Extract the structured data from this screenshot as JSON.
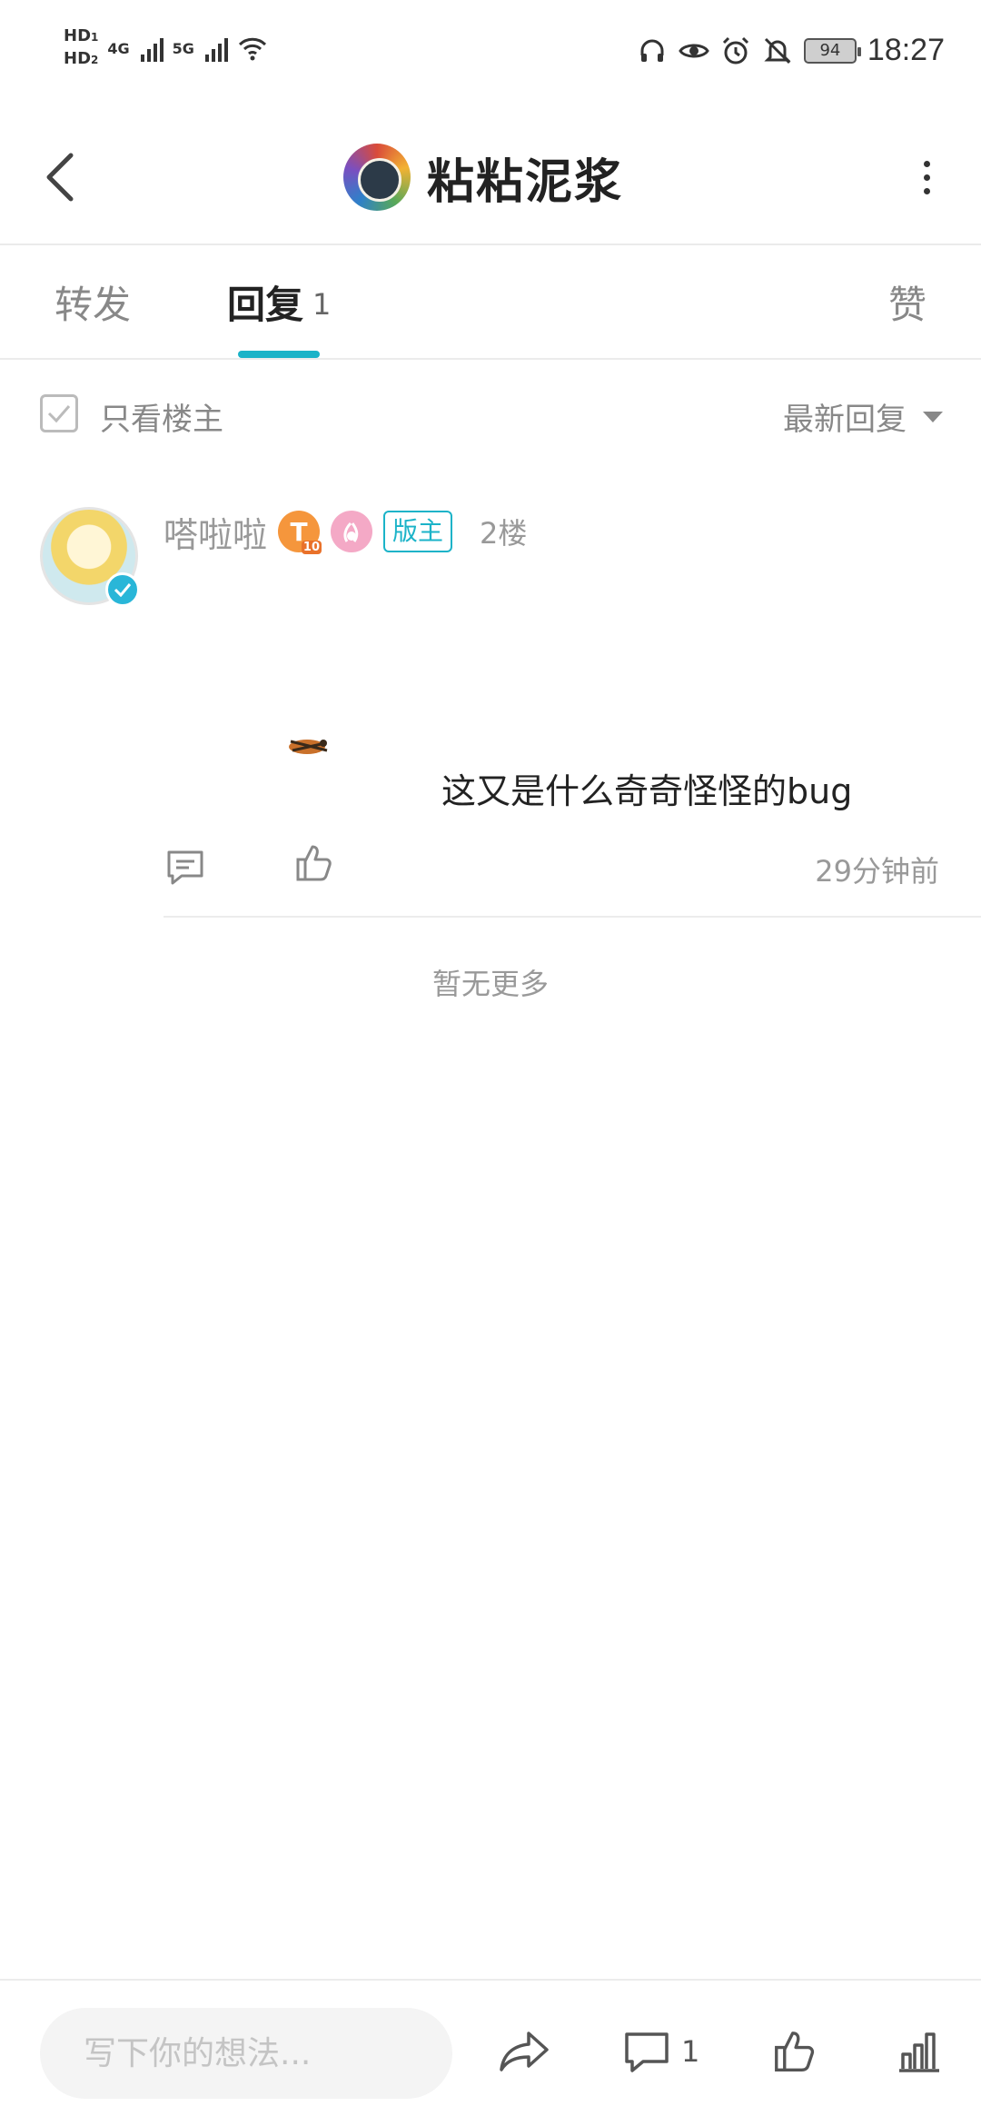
{
  "status_bar": {
    "hd1": "HD",
    "hd1_sub": "1",
    "hd2": "HD",
    "hd2_sub": "2",
    "net1": "4G",
    "net2": "5G",
    "battery": "94",
    "time": "18:27"
  },
  "header": {
    "title": "粘粘泥浆"
  },
  "tabs": {
    "forward": "转发",
    "reply": "回复",
    "reply_count": "1",
    "like": "赞"
  },
  "filter": {
    "only_op_label": "只看楼主",
    "sort_label": "最新回复"
  },
  "reply": {
    "username": "嗒啦啦",
    "badge_t": "T",
    "badge_t_level": "10",
    "moderator_badge": "版主",
    "floor": "2楼",
    "text": "这又是什么奇奇怪怪的bug",
    "time": "29分钟前"
  },
  "no_more": "暂无更多",
  "bottom_bar": {
    "input_placeholder": "写下你的想法...",
    "comment_count": "1"
  },
  "colors": {
    "accent": "#1bb3c8",
    "text_primary": "#222222",
    "text_secondary": "#999999"
  }
}
